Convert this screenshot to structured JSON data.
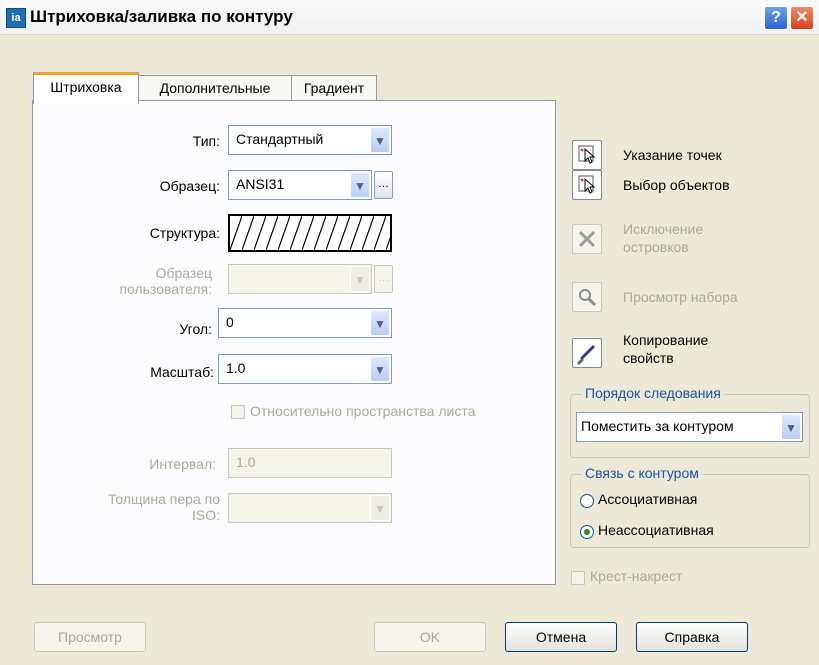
{
  "dialog": {
    "title": "Штриховка/заливка по контуру",
    "help": "?",
    "close": "✕"
  },
  "tabs": [
    "Штриховка",
    "Дополнительные",
    "Градиент"
  ],
  "hatch": {
    "type_label": "Тип:",
    "type_value": "Стандартный",
    "pattern_label": "Образец:",
    "pattern_value": "ANSI31",
    "structure_label": "Структура:",
    "custom_label_1": "Образец",
    "custom_label_2": "пользователя:",
    "angle_label": "Угол:",
    "angle_value": "0",
    "scale_label": "Масштаб:",
    "scale_value": "1.0",
    "relative_label": "Относительно пространства листа",
    "spacing_label": "Интервал:",
    "spacing_value": "1.0",
    "iso_label_1": "Толщина пера по",
    "iso_label_2": "ISO:"
  },
  "actions": {
    "pick_points": "Указание точек",
    "select_objects": "Выбор объектов",
    "remove_islands_1": "Исключение",
    "remove_islands_2": "островков",
    "view_selection": "Просмотр набора",
    "inherit_1": "Копирование",
    "inherit_2": "свойств"
  },
  "draw_order": {
    "label": "Порядок следования",
    "value": "Поместить за контуром"
  },
  "association": {
    "label": "Связь с контуром",
    "associative": "Ассоциативная",
    "nonassociative": "Неассоциативная",
    "selected": "nonassociative"
  },
  "double_label": "Крест-накрест",
  "buttons": {
    "preview": "Просмотр",
    "ok": "OK",
    "cancel": "Отмена",
    "help": "Справка"
  }
}
